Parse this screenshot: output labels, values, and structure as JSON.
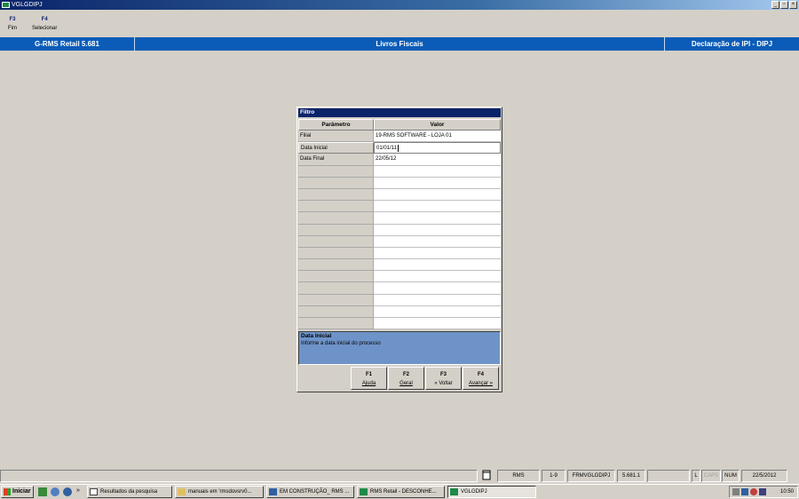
{
  "window": {
    "title": "VGLGDIPJ",
    "controls": [
      "_",
      "▫",
      "×"
    ]
  },
  "fkeys": [
    {
      "key": "F3",
      "label": "Fim"
    },
    {
      "key": "F4",
      "label": "Selecionar"
    }
  ],
  "header": {
    "left": "G-RMS Retail 5.681",
    "center": "Livros Fiscais",
    "right": "Declaração de IPI - DIPJ"
  },
  "dialog": {
    "title": "Filtro",
    "columns": {
      "param": "Parâmetro",
      "value": "Valor"
    },
    "rows": [
      {
        "param": "Filial",
        "value": "19-RMS SOFTWARE - LOJA 01"
      },
      {
        "param": "Data Inicial",
        "value": "01/01/11"
      },
      {
        "param": "Data Final",
        "value": "22/05/12"
      }
    ],
    "description": {
      "title": "Data Inicial",
      "text": "Informe a data inicial do processo"
    },
    "buttons": [
      {
        "key": "F1",
        "label": "Ajuda"
      },
      {
        "key": "F2",
        "label": "Geral"
      },
      {
        "key": "F3",
        "label": "« Voltar"
      },
      {
        "key": "F4",
        "label": "Avançar »"
      }
    ]
  },
  "statusbar": {
    "module": "RMS",
    "range": "1-9",
    "form": "FRMVGLGDIPJ",
    "version": "5.681.1",
    "l": "L",
    "caps": "CAPS",
    "num": "NUM",
    "date": "22/5/2012"
  },
  "taskbar": {
    "start": "Iniciar",
    "tasks": [
      "Resultados da pesquisa",
      "manuais em 'rmsdovsrv0...",
      "EM CONSTRUÇÃO_ RMS ...",
      "RMS Retail - DESCONHE...",
      "VGLGDIPJ"
    ],
    "clock": "10:50"
  }
}
